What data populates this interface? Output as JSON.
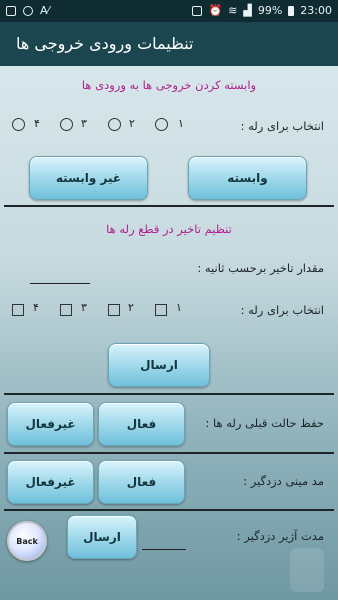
{
  "status_bar": {
    "left_icons": [
      "gallery-icon",
      "settings-icon",
      "aparat-icon"
    ],
    "right_icons": [
      "sim-icon",
      "alarm-icon",
      "wifi-icon",
      "signal-icon"
    ],
    "battery": "99%",
    "time": "23:00"
  },
  "app_bar": {
    "title": "تنظیمات ورودی خروجی ها"
  },
  "section_link": {
    "header": "وابسته کردن خروجی ها به ورودی ها",
    "relay_label": "انتخاب برای رله :",
    "relay_options": [
      "۱",
      "۲",
      "۳",
      "۴"
    ],
    "dependent_button": "وابسته",
    "independent_button": "غیر وابسته"
  },
  "section_delay": {
    "header": "تنظیم تاخیر در قطع رله ها",
    "delay_label": "مقدار تاخیر برحسب ثانیه :",
    "delay_value": "",
    "relay_label": "انتخاب برای رله :",
    "relay_options": [
      "۱",
      "۲",
      "۳",
      "۴"
    ],
    "send_button": "ارسال"
  },
  "preserve_state": {
    "label": "حفظ حالت قبلی رله ها :",
    "active_button": "فعال",
    "inactive_button": "غیرفعال"
  },
  "alarm_mode": {
    "label": "مد مینی دزدگیر :",
    "active_button": "فعال",
    "inactive_button": "غیرفعال"
  },
  "alarm_duration": {
    "label": "مدت آژیر دزدگیر :",
    "value": "",
    "send_button": "ارسال"
  },
  "back_button": "Back"
}
